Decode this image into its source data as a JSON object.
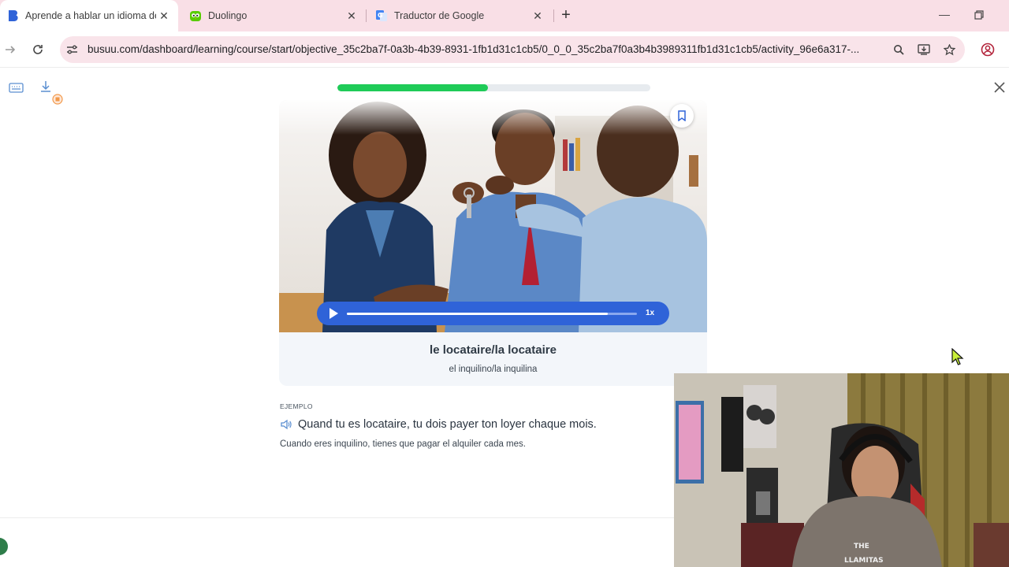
{
  "browser": {
    "tabs": [
      {
        "title": "Aprende a hablar un idioma de",
        "active": true,
        "icon": "busuu-favicon"
      },
      {
        "title": "Duolingo",
        "active": false,
        "icon": "duolingo-owl-favicon"
      },
      {
        "title": "Traductor de Google",
        "active": false,
        "icon": "google-translate-favicon"
      }
    ],
    "url": "busuu.com/dashboard/learning/course/start/objective_35c2ba7f-0a3b-4b39-8931-1fb1d31c1cb5/0_0_0_35c2ba7f0a3b4b3989311fb1d31c1cb5/activity_96e6a317-..."
  },
  "lesson": {
    "progress": 0.48,
    "audio_progress": 0.9,
    "speed": "1x",
    "word": "le locataire/la locataire",
    "word_translation": "el inquilino/la inquilina",
    "example_label": "EJEMPLO",
    "example_sentence": "Quand tu es locataire, tu dois payer ton loyer chaque mois.",
    "example_translation": "Cuando eres inquilino, tienes que pagar el alquiler cada mes."
  },
  "colors": {
    "tab_bar": "#f9dfe6",
    "progress": "#1fcb58",
    "player": "#2f63d8",
    "accent_icon": "#5b8fd1"
  }
}
